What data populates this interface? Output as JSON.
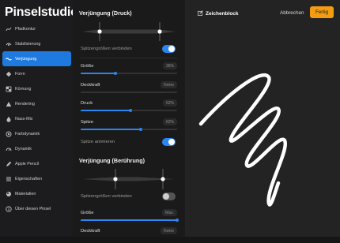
{
  "app": {
    "title": "Pinselstudio"
  },
  "sidebar": {
    "items": [
      {
        "label": "Pfadkontur",
        "icon": "path-icon"
      },
      {
        "label": "Stabilisierung",
        "icon": "stabilize-icon"
      },
      {
        "label": "Verjüngung",
        "icon": "taper-icon",
        "active": true
      },
      {
        "label": "Form",
        "icon": "shape-icon"
      },
      {
        "label": "Körnung",
        "icon": "grain-icon"
      },
      {
        "label": "Rendering",
        "icon": "rendering-icon"
      },
      {
        "label": "Nass-Mix",
        "icon": "wet-mix-icon"
      },
      {
        "label": "Farbdynamik",
        "icon": "color-dynamics-icon"
      },
      {
        "label": "Dynamik",
        "icon": "dynamics-icon"
      },
      {
        "label": "Apple Pencil",
        "icon": "pencil-icon"
      },
      {
        "label": "Eigenschaften",
        "icon": "properties-icon"
      },
      {
        "label": "Materialien",
        "icon": "materials-icon"
      },
      {
        "label": "Über diesen Pinsel",
        "icon": "info-icon"
      }
    ]
  },
  "pressure_taper": {
    "heading": "Verjüngung (Druck)",
    "link_sizes_label": "Spitzengrößen verbinden",
    "link_sizes_on": true,
    "size": {
      "label": "Größe",
      "value": "36%",
      "fraction": 0.36
    },
    "opacity": {
      "label": "Deckkraft",
      "value": "Keine",
      "fraction": 0.0
    },
    "pressure": {
      "label": "Druck",
      "value": "52%",
      "fraction": 0.52
    },
    "tip": {
      "label": "Spitze",
      "value": "62%",
      "fraction": 0.62
    },
    "animate_label": "Spitze animieren",
    "animate_on": true
  },
  "touch_taper": {
    "heading": "Verjüngung (Berührung)",
    "link_sizes_label": "Spitzengrößen verbinden",
    "link_sizes_on": false,
    "size": {
      "label": "Größe",
      "value": "Max.",
      "fraction": 1.0
    },
    "opacity": {
      "label": "Deckkraft",
      "value": "Keine",
      "fraction": 0.0
    }
  },
  "pad": {
    "title": "Zeichenblock",
    "cancel_label": "Abbrechen",
    "done_label": "Fertig"
  },
  "colors": {
    "accent": "#2d86f0",
    "done": "#f39c12"
  }
}
